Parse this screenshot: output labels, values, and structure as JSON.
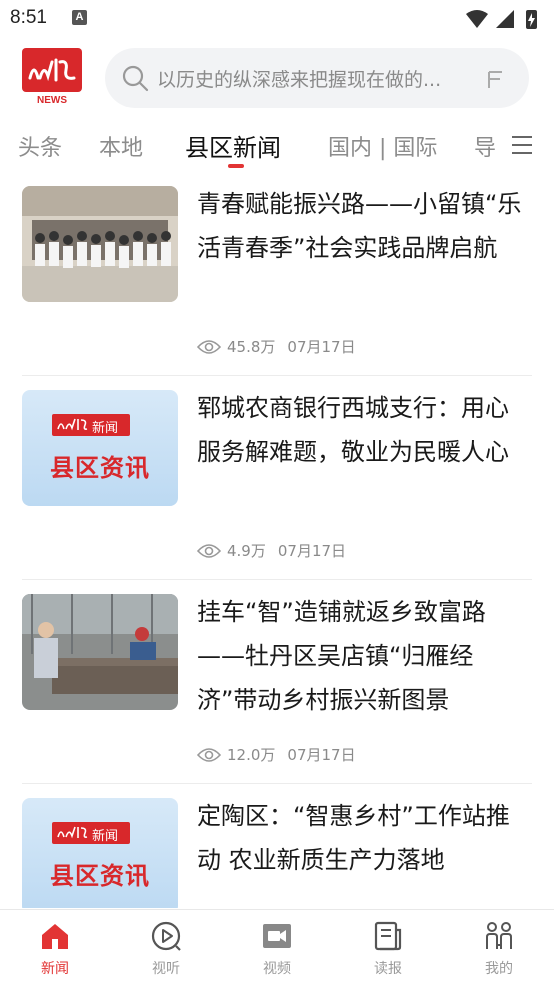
{
  "status_bar": {
    "time": "8:51",
    "notification_icon": "A"
  },
  "header": {
    "logo_text": "NEWS",
    "search": {
      "placeholder": "以历史的纵深感来把握现在做的..."
    }
  },
  "tabs": [
    {
      "label": "头条"
    },
    {
      "label": "本地"
    },
    {
      "label": "县区新闻"
    },
    {
      "label": "国内 | 国际"
    },
    {
      "label": "导"
    }
  ],
  "active_tab": "县区新闻",
  "articles": [
    {
      "title": "青春赋能振兴路——小留镇“乐活青春季”社会实践品牌启航",
      "views": "45.8万",
      "date": "07月17日",
      "thumb": "group-photo"
    },
    {
      "title": "郓城农商银行西城支行：用心服务解难题，敬业为民暖人心",
      "views": "4.9万",
      "date": "07月17日",
      "thumb": "county-news-banner",
      "thumb_brand": "新闻",
      "thumb_text": "县区资讯"
    },
    {
      "title": "挂车“智”造铺就返乡致富路——牡丹区吴店镇“归雁经济”带动乡村振兴新图景",
      "views": "12.0万",
      "date": "07月17日",
      "thumb": "factory-photo"
    },
    {
      "title": "定陶区：“智惠乡村”工作站推动 农业新质生产力落地",
      "views": "",
      "date": "",
      "thumb": "county-news-banner",
      "thumb_brand": "新闻",
      "thumb_text": "县区资讯"
    }
  ],
  "bottom_nav": [
    {
      "label": "新闻",
      "icon": "home-icon"
    },
    {
      "label": "视听",
      "icon": "play-circle-icon"
    },
    {
      "label": "视频",
      "icon": "video-camera-icon"
    },
    {
      "label": "读报",
      "icon": "newspaper-icon"
    },
    {
      "label": "我的",
      "icon": "profile-icon"
    }
  ],
  "colors": {
    "accent": "#e23434",
    "text": "#1a1a1a",
    "muted": "#8a8a8a",
    "search_bg": "#f2f3f5"
  }
}
